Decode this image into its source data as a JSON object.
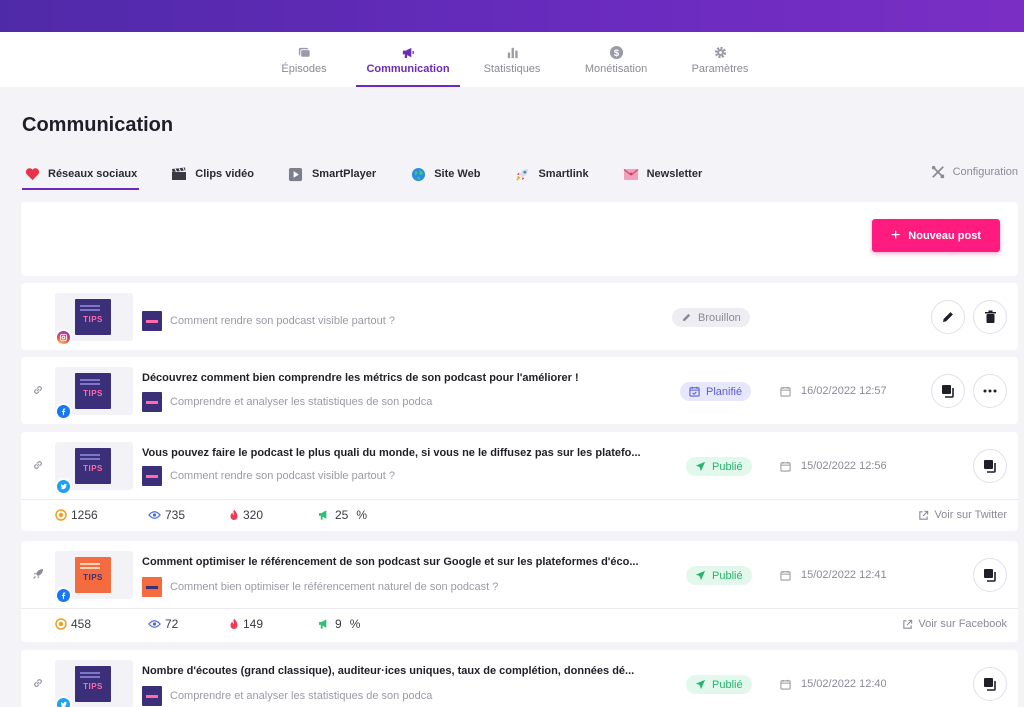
{
  "nav": {
    "items": [
      {
        "label": "Épisodes",
        "icon": "episodes-icon"
      },
      {
        "label": "Communication",
        "icon": "megaphone-icon",
        "active": true
      },
      {
        "label": "Statistiques",
        "icon": "bar-chart-icon"
      },
      {
        "label": "Monétisation",
        "icon": "dollar-icon"
      },
      {
        "label": "Paramètres",
        "icon": "gear-icon"
      }
    ]
  },
  "page": {
    "title": "Communication"
  },
  "subtabs": [
    {
      "label": "Réseaux sociaux",
      "icon": "heart-icon",
      "active": true
    },
    {
      "label": "Clips vidéo",
      "icon": "clapperboard-icon"
    },
    {
      "label": "SmartPlayer",
      "icon": "play-icon"
    },
    {
      "label": "Site Web",
      "icon": "globe-icon"
    },
    {
      "label": "Smartlink",
      "icon": "rocket-icon"
    },
    {
      "label": "Newsletter",
      "icon": "envelope-icon"
    }
  ],
  "config_label": "Configuration",
  "new_post_label": "Nouveau post",
  "posts": [
    {
      "network": "instagram",
      "title": "",
      "episode": "Comment rendre son podcast visible partout ?",
      "status": "Brouillon",
      "date": "",
      "actions": [
        "edit",
        "delete"
      ]
    },
    {
      "network": "facebook",
      "title": "Découvrez comment bien comprendre les métrics de son podcast pour l'améliorer !",
      "episode": "Comprendre et analyser les statistiques de son podca",
      "status": "Planifié",
      "date": "16/02/2022 12:57",
      "actions": [
        "duplicate",
        "more"
      ]
    },
    {
      "network": "twitter",
      "title": "Vous pouvez faire le podcast le plus quali du monde, si vous ne le diffusez pas sur les platefo...",
      "episode": "Comment rendre son podcast visible partout ?",
      "status": "Publié",
      "date": "15/02/2022 12:56",
      "actions": [
        "duplicate"
      ],
      "stats": {
        "reach": "1256",
        "views": "735",
        "engagement": "320",
        "rate": "25",
        "rate_unit": "%"
      },
      "view_link": "Voir sur Twitter"
    },
    {
      "network": "facebook",
      "title": "Comment optimiser le référencement de son podcast sur Google et sur les plateformes d'éco...",
      "episode": "Comment bien optimiser le référencement naturel de son podcast ?",
      "status": "Publié",
      "date": "15/02/2022 12:41",
      "actions": [
        "duplicate"
      ],
      "stats": {
        "reach": "458",
        "views": "72",
        "engagement": "149",
        "rate": "9",
        "rate_unit": "%"
      },
      "view_link": "Voir sur Facebook"
    },
    {
      "network": "twitter",
      "title": "Nombre d'écoutes (grand classique), auditeur·ices uniques, taux de complétion, données dé...",
      "episode": "Comprendre et analyser les statistiques de son podca",
      "status": "Publié",
      "date": "15/02/2022 12:40",
      "actions": [
        "duplicate"
      ]
    }
  ],
  "colors": {
    "accent": "#6c2bbd",
    "cta": "#ff1c7e",
    "published": "#26b36b",
    "planned": "#5b5bd6"
  }
}
